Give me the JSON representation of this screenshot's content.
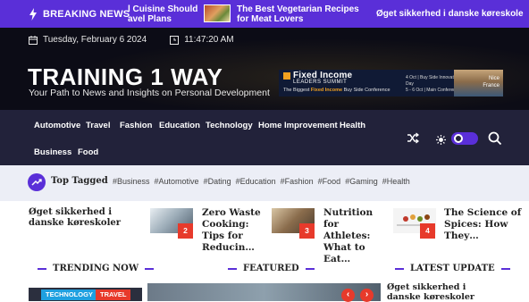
{
  "breaking": {
    "badge_label": "BREAKING NEWS",
    "items": [
      "l Cuisine Should avel Plans",
      "The Best Vegetarian Recipes for Meat Lovers",
      "Øget sikkerhed i danske køreskole"
    ]
  },
  "header": {
    "date": "Tuesday, February 6 2024",
    "time": "11:47:20 AM",
    "site_title": "TRAINING 1 WAY",
    "tagline": "Your Path to News and Insights on Personal Development",
    "ad": {
      "title": "Fixed Income",
      "subtitle": "LEADERS SUMMIT",
      "line": "The Biggest Fixed Income Buy Side Conference",
      "highlight": "Fixed Income",
      "info_1": "4 Oct | Buy Side Innovation Day",
      "info_2": "5 - 6 Oct | Main Conference",
      "city_1": "Nice",
      "city_2": "France"
    }
  },
  "nav": {
    "items": [
      "Automotive",
      "Travel",
      "Fashion",
      "Education",
      "Technology",
      "Home Improvement",
      "Health",
      "Business",
      "Food"
    ],
    "icons": [
      "shuffle-icon",
      "sun-icon",
      "search-icon"
    ]
  },
  "tagged": {
    "label": "Top Tagged",
    "tags": [
      "#Business",
      "#Automotive",
      "#Dating",
      "#Education",
      "#Fashion",
      "#Food",
      "#Gaming",
      "#Health"
    ]
  },
  "headlines": {
    "first": "Øget sikkerhed i danske køreskoler",
    "items": [
      {
        "number": "2",
        "title": "Zero Waste Cooking: Tips for Reducin…"
      },
      {
        "number": "3",
        "title": "Nutrition for Athletes: What to Eat…"
      },
      {
        "number": "4",
        "title": "The Science of Spices: How They…"
      }
    ]
  },
  "sections": {
    "trending": "TRENDING NOW",
    "featured": "FEATURED",
    "latest": "LATEST UPDATE",
    "chip_1": "TECHNOLOGY",
    "chip_2": "TRAVEL",
    "latest_title": "Øget sikkerhed i danske køreskoler",
    "arrow_prev": "‹",
    "arrow_next": "›"
  },
  "colors": {
    "accent": "#5a2fd8",
    "header_bg": "#0c0c16",
    "nav_bg": "#22223a",
    "tag_bg": "#eceef6",
    "number_badge": "#e73a2b",
    "chip_technology": "#1fa0e0",
    "chip_travel": "#e73a2b"
  }
}
